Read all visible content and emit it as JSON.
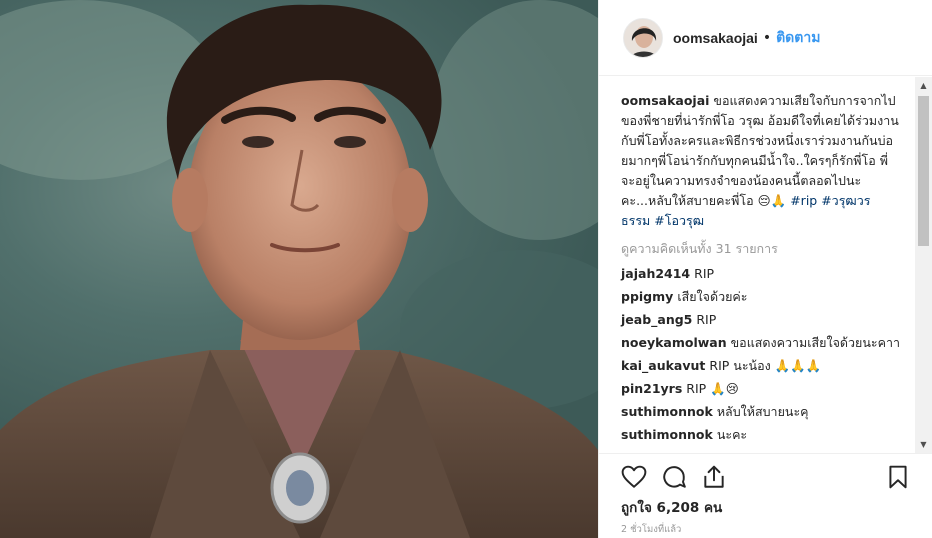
{
  "post": {
    "username": "oomsakaojai",
    "dot": "•",
    "follow_label": "ติดตาม",
    "caption_user": "oomsakaojai",
    "caption_text": "ขอแสดงความเสียใจกับการจากไปของพี่ชายที่น่ารักพี่โอ วรุฒ อ้อมดีใจที่เคยได้ร่วมงานกับพี่โอทั้งละครและพิธีกรช่วงหนึ่งเราร่วมงานกันบ่อยมากๆพี่โอน่ารักกับทุกคนมีน้ำใจ..ใครๆก็รักพี่โอ พี่จะอยู่ในความทรงจำของน้องคนนี้ตลอดไปนะคะ...หลับให้สบายคะพี่โอ",
    "caption_emoji": "😔🙏",
    "hashtags": "#rip #วรุฒวรธรรม #โอวรุฒ",
    "view_all": "ดูความคิดเห็นทั้ง 31 รายการ",
    "comments": [
      {
        "user": "jajah2414",
        "text": "RIP"
      },
      {
        "user": "ppigmy",
        "text": "เสียใจด้วยค่ะ"
      },
      {
        "user": "jeab_ang5",
        "text": "RIP"
      },
      {
        "user": "noeykamolwan",
        "text": "ขอแสดงความเสียใจด้วยนะคาา"
      },
      {
        "user": "kai_aukavut",
        "text": "RIP นะน้อง 🙏🙏🙏"
      },
      {
        "user": "pin21yrs",
        "text": "RIP 🙏😢"
      },
      {
        "user": "suthimonnok",
        "text": "หลับให้สบายนะคุ"
      },
      {
        "user": "suthimonnok",
        "text": "นะคะ"
      }
    ],
    "likes_label": "ถูกใจ 6,208 คน",
    "time_ago": "2 ชั่วโมงที่แล้ว"
  },
  "icons": {
    "like": "heart-icon",
    "comment": "comment-icon",
    "share": "share-icon",
    "save": "bookmark-icon"
  },
  "colors": {
    "link_blue": "#3897f0",
    "hashtag": "#003569",
    "muted": "#999999"
  }
}
